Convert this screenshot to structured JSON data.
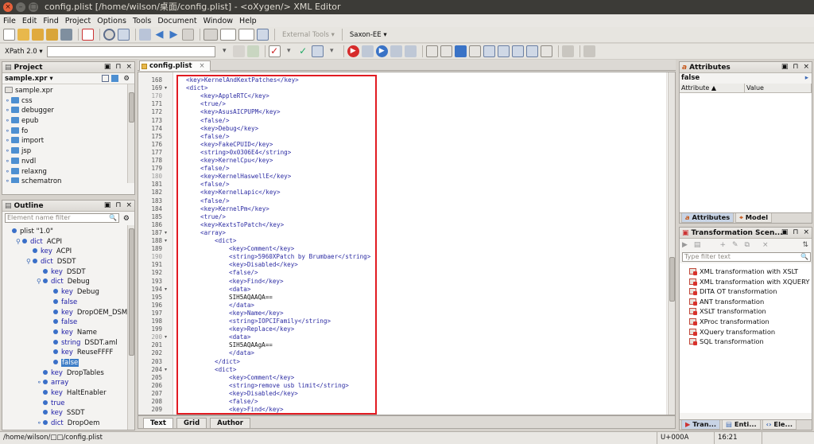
{
  "window": {
    "title": "config.plist [/home/wilson/桌面/config.plist] - <oXygen/> XML Editor",
    "btn_close": "×",
    "btn_min": "–",
    "btn_max": "□"
  },
  "menu": [
    "File",
    "Edit",
    "Find",
    "Project",
    "Options",
    "Tools",
    "Document",
    "Window",
    "Help"
  ],
  "toolbar": {
    "external_tools": "External Tools",
    "external_tools_caret": "▾",
    "transformer": "Saxon-EE",
    "transformer_caret": "▾",
    "xpath_label": "XPath 2.0",
    "xpath_caret": "▾"
  },
  "project": {
    "title": "Project",
    "file": "sample.xpr",
    "file_caret": "▾",
    "items": [
      "sample.xpr",
      "css",
      "debugger",
      "epub",
      "fo",
      "import",
      "jsp",
      "nvdl",
      "relaxng",
      "schematron"
    ],
    "ctrl_restore": "▣",
    "ctrl_pin": "⊓",
    "ctrl_close": "×"
  },
  "outline": {
    "title": "Outline",
    "filter_placeholder": "Element name filter",
    "filter_search_icon": "🔍",
    "settings_icon": "⚙",
    "ctrl_restore": "▣",
    "ctrl_pin": "⊓",
    "ctrl_close": "×",
    "rows": [
      {
        "indent": 0,
        "kind": "",
        "label": "plist \"1.0\"",
        "tog": ""
      },
      {
        "indent": 1,
        "kind": "dict",
        "label": "ACPI",
        "tog": "⚲"
      },
      {
        "indent": 2,
        "kind": "key",
        "label": "ACPI",
        "tog": ""
      },
      {
        "indent": 2,
        "kind": "dict",
        "label": "DSDT",
        "tog": "⚲"
      },
      {
        "indent": 3,
        "kind": "key",
        "label": "DSDT",
        "tog": ""
      },
      {
        "indent": 3,
        "kind": "dict",
        "label": "Debug",
        "tog": "⚲"
      },
      {
        "indent": 4,
        "kind": "key",
        "label": "Debug",
        "tog": ""
      },
      {
        "indent": 4,
        "kind": "false",
        "label": "",
        "tog": ""
      },
      {
        "indent": 4,
        "kind": "key",
        "label": "DropOEM_DSM",
        "tog": ""
      },
      {
        "indent": 4,
        "kind": "false",
        "label": "",
        "tog": ""
      },
      {
        "indent": 4,
        "kind": "key",
        "label": "Name",
        "tog": ""
      },
      {
        "indent": 4,
        "kind": "string",
        "label": "DSDT.aml",
        "tog": ""
      },
      {
        "indent": 4,
        "kind": "key",
        "label": "ReuseFFFF",
        "tog": ""
      },
      {
        "indent": 4,
        "kind": "false",
        "label": "",
        "tog": "",
        "selected": true
      },
      {
        "indent": 3,
        "kind": "key",
        "label": "DropTables",
        "tog": ""
      },
      {
        "indent": 3,
        "kind": "array",
        "label": "",
        "tog": "⚬"
      },
      {
        "indent": 3,
        "kind": "key",
        "label": "HaltEnabler",
        "tog": ""
      },
      {
        "indent": 3,
        "kind": "true",
        "label": "",
        "tog": ""
      },
      {
        "indent": 3,
        "kind": "key",
        "label": "SSDT",
        "tog": ""
      },
      {
        "indent": 3,
        "kind": "dict",
        "label": "DropOem",
        "tog": "⚬"
      }
    ]
  },
  "editor": {
    "tab": "config.plist",
    "tab_close": "×",
    "lines": [
      {
        "n": "168",
        "t": "<key>KernelAndKextPatches</key>",
        "i": 1
      },
      {
        "n": "169",
        "t": "<dict>",
        "i": 1,
        "f": "▾"
      },
      {
        "n": "170",
        "t": "<key>AppleRTC</key>",
        "i": 2,
        "dim": true
      },
      {
        "n": "171",
        "t": "<true/>",
        "i": 2
      },
      {
        "n": "172",
        "t": "<key>AsusAICPUPM</key>",
        "i": 2
      },
      {
        "n": "173",
        "t": "<false/>",
        "i": 2
      },
      {
        "n": "174",
        "t": "<key>Debug</key>",
        "i": 2
      },
      {
        "n": "175",
        "t": "<false/>",
        "i": 2
      },
      {
        "n": "176",
        "t": "<key>FakeCPUID</key>",
        "i": 2
      },
      {
        "n": "177",
        "t": "<string>0x0306E4</string>",
        "i": 2
      },
      {
        "n": "178",
        "t": "<key>KernelCpu</key>",
        "i": 2
      },
      {
        "n": "179",
        "t": "<false/>",
        "i": 2
      },
      {
        "n": "180",
        "t": "<key>KernelHaswellE</key>",
        "i": 2,
        "dim": true
      },
      {
        "n": "181",
        "t": "<false/>",
        "i": 2
      },
      {
        "n": "182",
        "t": "<key>KernelLapic</key>",
        "i": 2
      },
      {
        "n": "183",
        "t": "<false/>",
        "i": 2
      },
      {
        "n": "184",
        "t": "<key>KernelPm</key>",
        "i": 2
      },
      {
        "n": "185",
        "t": "<true/>",
        "i": 2
      },
      {
        "n": "186",
        "t": "<key>KextsToPatch</key>",
        "i": 2
      },
      {
        "n": "187",
        "t": "<array>",
        "i": 2,
        "f": "▾"
      },
      {
        "n": "188",
        "t": "<dict>",
        "i": 3,
        "f": "▾"
      },
      {
        "n": "189",
        "t": "<key>Comment</key>",
        "i": 4
      },
      {
        "n": "190",
        "t": "<string>5960XPatch by Brumbaer</string>",
        "i": 4,
        "dim": true
      },
      {
        "n": "191",
        "t": "<key>Disabled</key>",
        "i": 4
      },
      {
        "n": "192",
        "t": "<false/>",
        "i": 4
      },
      {
        "n": "193",
        "t": "<key>Find</key>",
        "i": 4
      },
      {
        "n": "194",
        "t": "<data>",
        "i": 4,
        "f": "▾"
      },
      {
        "n": "195",
        "t": "SIH5AQAAQA==",
        "i": 4,
        "text": true
      },
      {
        "n": "196",
        "t": "</data>",
        "i": 4
      },
      {
        "n": "197",
        "t": "<key>Name</key>",
        "i": 4
      },
      {
        "n": "198",
        "t": "<string>IOPCIFamily</string>",
        "i": 4
      },
      {
        "n": "199",
        "t": "<key>Replace</key>",
        "i": 4
      },
      {
        "n": "200",
        "t": "<data>",
        "i": 4,
        "f": "▾",
        "dim": true
      },
      {
        "n": "201",
        "t": "SIH5AQAAgA==",
        "i": 4,
        "text": true
      },
      {
        "n": "202",
        "t": "</data>",
        "i": 4
      },
      {
        "n": "203",
        "t": "</dict>",
        "i": 3
      },
      {
        "n": "204",
        "t": "<dict>",
        "i": 3,
        "f": "▾"
      },
      {
        "n": "205",
        "t": "<key>Comment</key>",
        "i": 4
      },
      {
        "n": "206",
        "t": "<string>remove usb limit</string>",
        "i": 4
      },
      {
        "n": "207",
        "t": "<key>Disabled</key>",
        "i": 4
      },
      {
        "n": "208",
        "t": "<false/>",
        "i": 4
      },
      {
        "n": "209",
        "t": "<key>Find</key>",
        "i": 4
      },
      {
        "n": "210",
        "t": "<data>",
        "i": 4,
        "dim": true
      }
    ],
    "bottom_tabs": [
      "Text",
      "Grid",
      "Author"
    ]
  },
  "attributes": {
    "title": "Attributes",
    "value": "false",
    "col_attribute": "Attribute",
    "col_value": "Value",
    "sort_icon": "▲",
    "ctrl_restore": "▣",
    "ctrl_pin": "⊓",
    "ctrl_close": "×",
    "tabs": [
      "Attributes",
      "Model"
    ]
  },
  "transformation": {
    "title": "Transformation Scen...",
    "filter_placeholder": "Type filter text",
    "filter_search_icon": "🔍",
    "ctrl_restore": "▣",
    "ctrl_pin": "⊓",
    "ctrl_close": "×",
    "items": [
      "XML transformation with XSLT",
      "XML transformation with XQUERY",
      "DITA OT transformation",
      "ANT transformation",
      "XSLT transformation",
      "XProc transformation",
      "XQuery transformation",
      "SQL transformation"
    ],
    "tabs": [
      "Tran...",
      "Enti...",
      "Ele..."
    ]
  },
  "status": {
    "path": "/home/wilson/□□/config.plist",
    "unicode": "U+000A",
    "time": "16:21"
  },
  "colors": {
    "accent": "#3d7dc7",
    "highlight": "#e11b22",
    "xml_tag": "#2c2ca3"
  }
}
